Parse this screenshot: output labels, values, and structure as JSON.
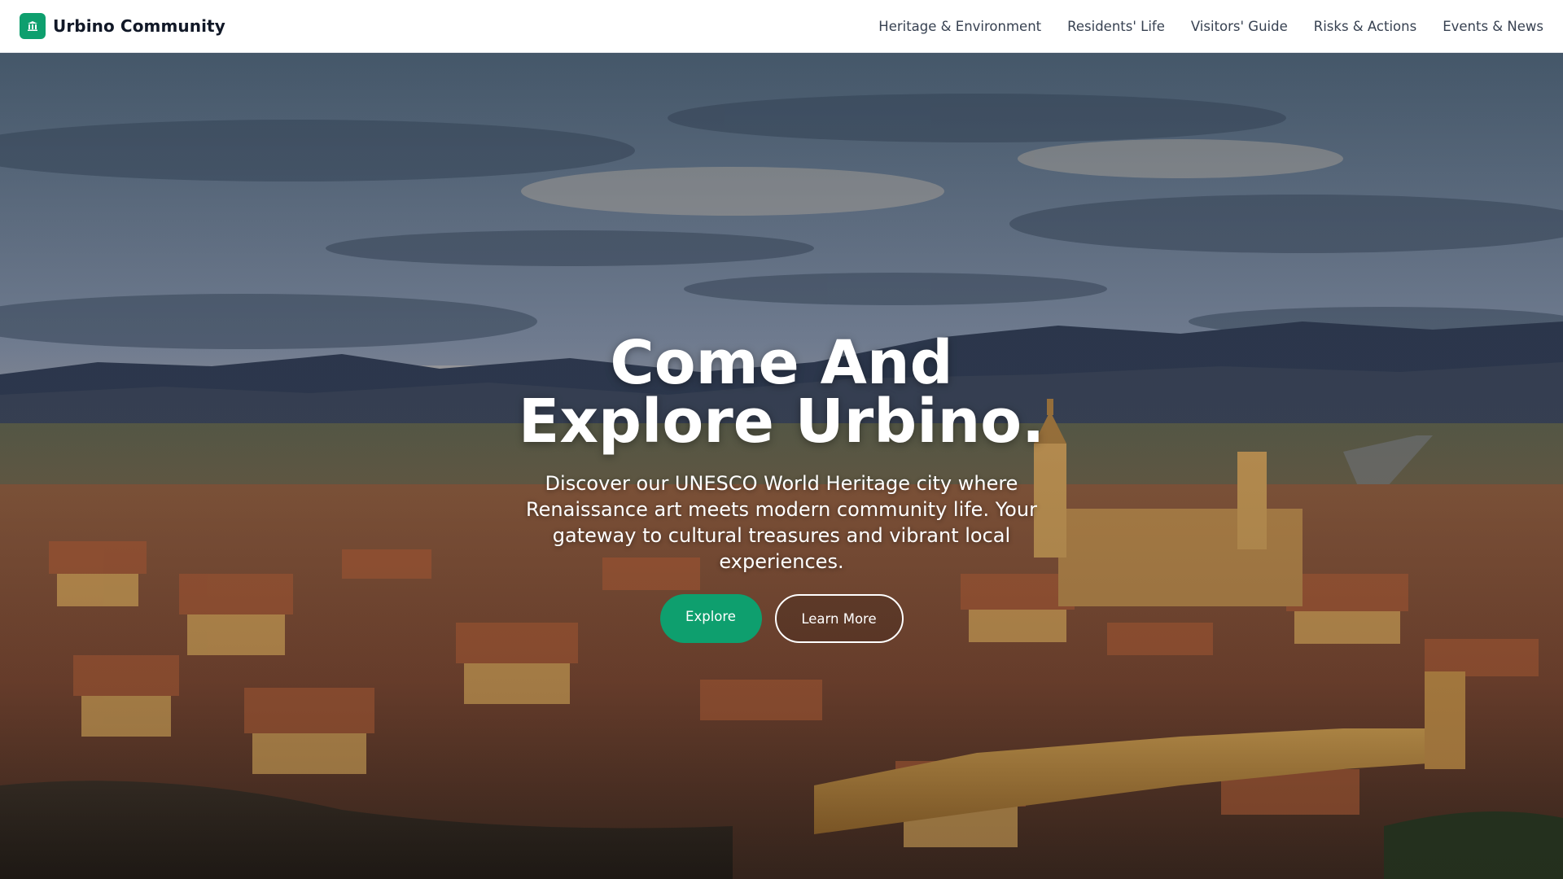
{
  "colors": {
    "accent": "#0e9f6e",
    "nav_text": "#374151",
    "brand_text": "#111827"
  },
  "brand": {
    "icon": "landmark-icon",
    "name": "Urbino Community"
  },
  "nav": {
    "items": [
      {
        "label": "Heritage & Environment"
      },
      {
        "label": "Residents' Life"
      },
      {
        "label": "Visitors' Guide"
      },
      {
        "label": "Risks & Actions"
      },
      {
        "label": "Events & News"
      }
    ]
  },
  "hero": {
    "title_line1": "Come And",
    "title_line2": "Explore Urbino.",
    "subtitle": "Discover our UNESCO World Heritage city where Renaissance art meets modern community life. Your gateway to cultural treasures and vibrant local experiences.",
    "primary_button": "Explore",
    "secondary_button": "Learn More"
  }
}
